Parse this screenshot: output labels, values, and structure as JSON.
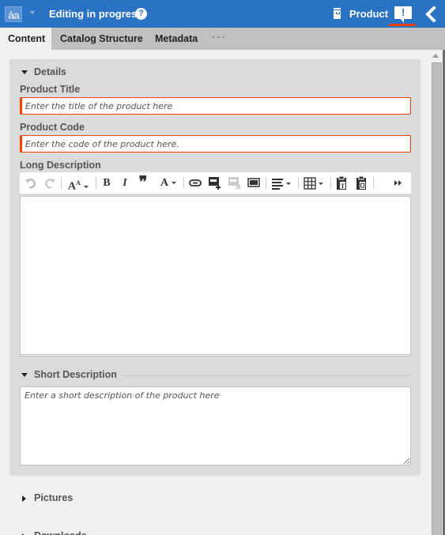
{
  "header": {
    "logo_text_a": "à",
    "logo_text_b": "a",
    "status_title": "Editing in progress",
    "help_icon": "?",
    "product_label": "Product",
    "notification_icon": "!",
    "back_icon": "chevron-left",
    "colors": {
      "bar": "#2a72c4",
      "alert_underline": "#f04010"
    }
  },
  "tabs": [
    {
      "label": "Content",
      "active": true
    },
    {
      "label": "Catalog Structure",
      "active": false
    },
    {
      "label": "Metadata",
      "active": false
    }
  ],
  "tabs_more": "···",
  "details": {
    "section_label": "Details",
    "product_title": {
      "label": "Product Title",
      "value": "",
      "placeholder": "Enter the title of the product here"
    },
    "product_code": {
      "label": "Product Code",
      "value": "",
      "placeholder": "Enter the code of the product here."
    },
    "long_description": {
      "label": "Long Description",
      "toolbar": {
        "undo": "undo-icon",
        "redo": "redo-icon",
        "font_size": "font-size-icon",
        "bold": "B",
        "italic": "I",
        "quote": "❞",
        "font_color": "A",
        "link": "link-icon",
        "insert_link": "insert-link-icon",
        "remove_link": "remove-link-icon",
        "embed": "embed-icon",
        "align": "align-icon",
        "table": "table-icon",
        "paste_text": "paste-text-icon",
        "paste_word": "paste-word-icon",
        "more": "more-icon"
      },
      "value": ""
    },
    "short_description": {
      "label": "Short Description",
      "value": "",
      "placeholder": "Enter a short description of the product here"
    }
  },
  "sections": [
    {
      "label": "Pictures",
      "expanded": false
    },
    {
      "label": "Downloads",
      "expanded": false
    }
  ],
  "colors": {
    "required_border": "#ff3d00",
    "panel_bg": "#dbdbdb"
  }
}
